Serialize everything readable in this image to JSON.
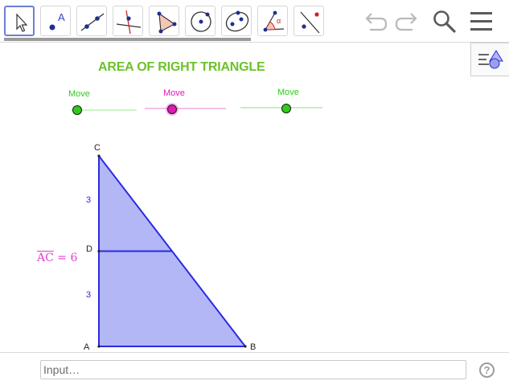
{
  "app": {
    "title": "AREA OF RIGHT TRIANGLE",
    "title_color": "#6dc12a"
  },
  "toolbar": {
    "tools": [
      {
        "icon": "move-tool-icon",
        "selected": true
      },
      {
        "icon": "point-tool-icon",
        "selected": false
      },
      {
        "icon": "line-tool-icon",
        "selected": false
      },
      {
        "icon": "perpendicular-line-tool-icon",
        "selected": false
      },
      {
        "icon": "polygon-tool-icon",
        "selected": false
      },
      {
        "icon": "circle-tool-icon",
        "selected": false
      },
      {
        "icon": "conic-tool-icon",
        "selected": false
      },
      {
        "icon": "angle-tool-icon",
        "selected": false
      },
      {
        "icon": "reflect-tool-icon",
        "selected": false
      }
    ],
    "actions": [
      "undo-icon",
      "redo-icon",
      "search-icon",
      "menu-icon"
    ]
  },
  "sliders": [
    {
      "label": "Move",
      "color": "#2ecc18"
    },
    {
      "label": "Move",
      "color": "#e01ab4"
    },
    {
      "label": "Move",
      "color": "#2ecc18"
    }
  ],
  "construction": {
    "points": {
      "A": "A",
      "B": "B",
      "C": "C",
      "D": "D"
    },
    "segment_labels": {
      "upper": "3",
      "lower": "3"
    },
    "ac_label": {
      "name": "AC",
      "equals": " = 6"
    },
    "fill_color": "#b3b7f5",
    "stroke_color": "#2a2ae0"
  },
  "input_bar": {
    "placeholder": "Input…",
    "help_label": "?"
  }
}
